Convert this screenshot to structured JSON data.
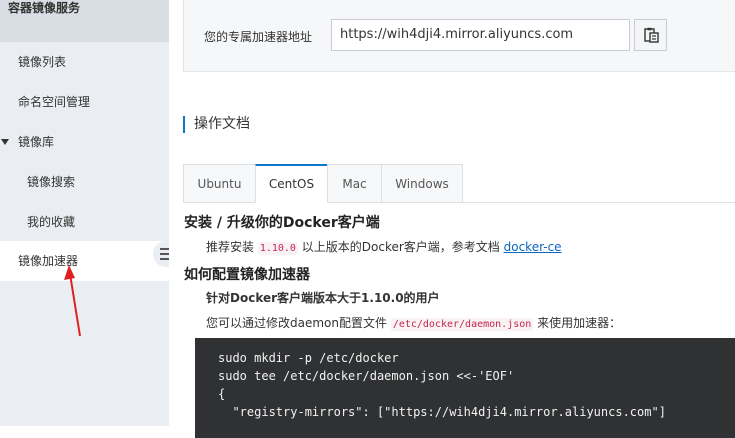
{
  "sidebar": {
    "title": "容器镜像服务",
    "items": [
      {
        "label": "镜像列表"
      },
      {
        "label": "命名空间管理"
      },
      {
        "label": "镜像库"
      },
      {
        "label": "镜像搜索"
      },
      {
        "label": "我的收藏"
      },
      {
        "label": "镜像加速器"
      }
    ]
  },
  "accelerator": {
    "label": "您的专属加速器地址",
    "url": "https://wih4dji4.mirror.aliyuncs.com",
    "copy_icon": "clipboard-icon"
  },
  "docs": {
    "section_title": "操作文档",
    "tabs": [
      "Ubuntu",
      "CentOS",
      "Mac",
      "Windows"
    ],
    "active_tab": "CentOS",
    "install_heading": "安装 / 升级你的Docker客户端",
    "install_text_before": "推荐安装 ",
    "install_version": "1.10.0",
    "install_text_after": " 以上版本的Docker客户端，参考文档 ",
    "install_link": "docker-ce",
    "config_heading": "如何配置镜像加速器",
    "config_subheading": "针对Docker客户端版本大于1.10.0的用户",
    "config_text_before": "您可以通过修改daemon配置文件 ",
    "config_path": "/etc/docker/daemon.json",
    "config_text_after": " 来使用加速器：",
    "code_lines": [
      "sudo mkdir -p /etc/docker",
      "sudo tee /etc/docker/daemon.json <<-'EOF'",
      "{",
      "  \"registry-mirrors\": [\"https://wih4dji4.mirror.aliyuncs.com\"]"
    ]
  },
  "colors": {
    "accent": "#0b78c8",
    "sidebar_bg": "#eaedf1",
    "code_bg": "#2f3133",
    "annotation_arrow": "#e02020"
  }
}
